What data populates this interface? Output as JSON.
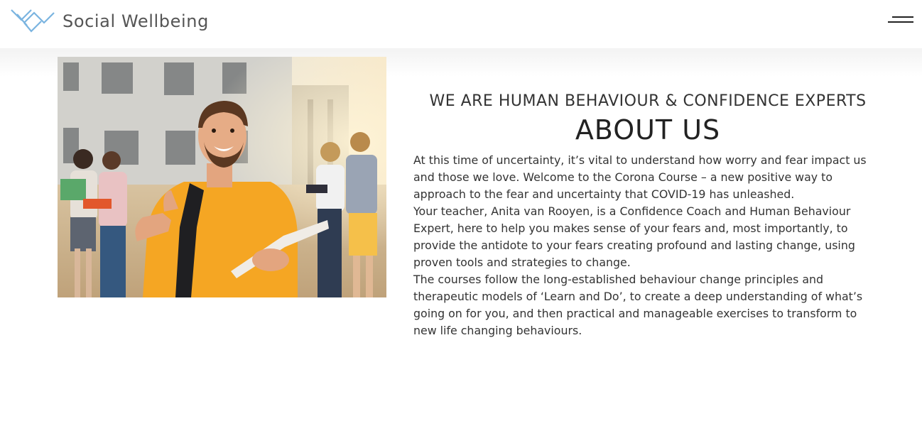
{
  "header": {
    "brand_name": "Social Wellbeing",
    "logo_icon": "intertwined-chevrons-logo",
    "menu_icon": "hamburger-menu-icon"
  },
  "colors": {
    "logo_blue": "#7ab4e0",
    "text_dark": "#222222",
    "brand_gray": "#555555",
    "photo_shirt": "#f5a623"
  },
  "hero_image": {
    "subject": "smiling-student-thumbs-up"
  },
  "about": {
    "eyebrow": "WE ARE HUMAN BEHAVIOUR & CONFIDENCE EXPERTS",
    "title": "ABOUT US",
    "paragraphs": [
      "At this time of uncertainty, it’s vital to understand how worry and fear impact us and those we love. Welcome to the Corona Course – a new positive way to approach to the fear and uncertainty that COVID-19 has unleashed.",
      "Your teacher, Anita van Rooyen, is a Confidence Coach and Human Behaviour Expert, here to help you makes sense of your fears and, most importantly, to provide the antidote to your fears creating profound and lasting change, using proven tools and strategies to change.",
      "The courses follow the long-established behaviour change principles and therapeutic models of ‘Learn and Do’, to create a deep understanding of what’s going on for you, and then practical and manageable exercises to transform to new life changing behaviours."
    ]
  }
}
